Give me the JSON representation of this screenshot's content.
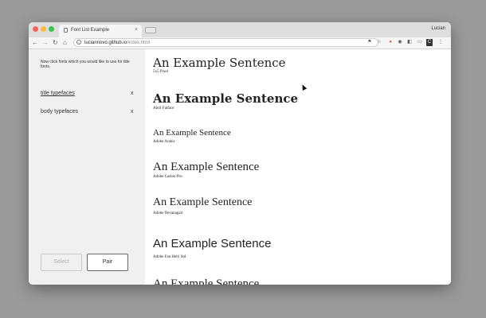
{
  "browser": {
    "tab_title": "Font List Example",
    "tab_close": "×",
    "user": "Lucian",
    "url_host": "luciannovo.github.io",
    "url_path": "/index.html",
    "nav": {
      "back": "←",
      "forward": "→",
      "reload": "↻",
      "home": "⌂"
    }
  },
  "sidebar": {
    "instructions": "Now click fonts which you would like to use for title fonts.",
    "categories": [
      {
        "label": "title typefaces",
        "remove": "x"
      },
      {
        "label": "body typefaces",
        "remove": "x"
      }
    ],
    "select_label": "Select",
    "pair_label": "Pair"
  },
  "fonts": [
    {
      "sample": "An Example Sentence",
      "name": "5x5 Pixel"
    },
    {
      "sample": "An Example Sentence",
      "name": "Abril Fatface"
    },
    {
      "sample": "An Example Sentence",
      "name": "Adobe Arabic"
    },
    {
      "sample": "An Example Sentence",
      "name": "Adobe Caslon Pro"
    },
    {
      "sample": "An Example Sentence",
      "name": "Adobe Devanagari"
    },
    {
      "sample": "An Example Sentence",
      "name": "Adobe Fan Heiti Std"
    },
    {
      "sample": "An Example Sentence",
      "name": ""
    }
  ],
  "colors": {
    "sidebar_bg": "#f0f0f0",
    "desktop_bg": "#9a9a9a"
  }
}
